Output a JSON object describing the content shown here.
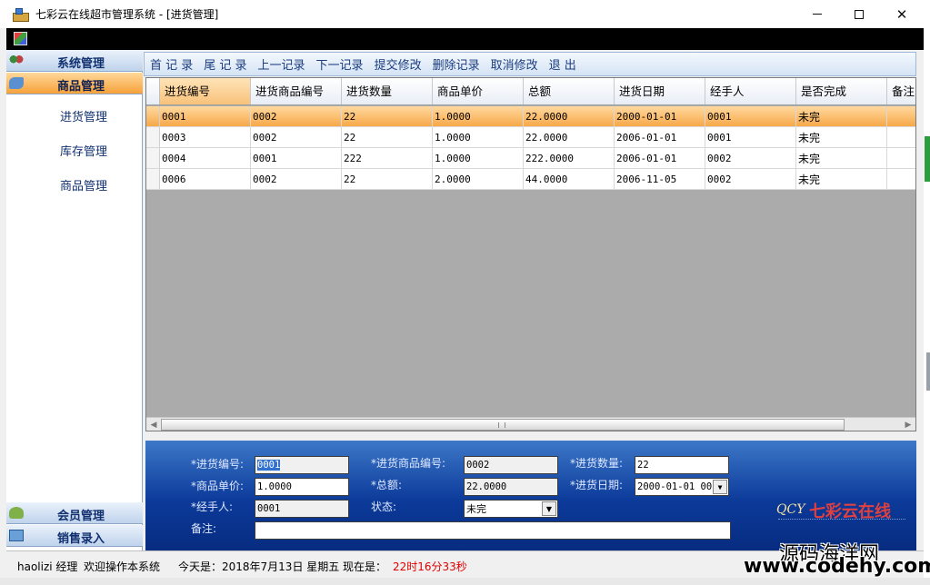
{
  "window": {
    "title": "七彩云在线超市管理系统 - [进货管理]"
  },
  "nav": {
    "sections": [
      {
        "label": "系统管理"
      },
      {
        "label": "商品管理"
      }
    ],
    "sub_items": [
      "进货管理",
      "库存管理",
      "商品管理"
    ],
    "bottom_sections": [
      {
        "label": "会员管理"
      },
      {
        "label": "销售录入"
      }
    ]
  },
  "toolbar": {
    "buttons": [
      "首 记 录",
      "尾 记 录",
      "上一记录",
      "下一记录",
      "提交修改",
      "删除记录",
      "取消修改",
      "退  出"
    ]
  },
  "grid": {
    "columns": [
      "进货编号",
      "进货商品编号",
      "进货数量",
      "商品单价",
      "总额",
      "进货日期",
      "经手人",
      "是否完成",
      "备注"
    ],
    "rows": [
      [
        "0001",
        "0002",
        "22",
        "1.0000",
        "22.0000",
        "2000-01-01",
        "0001",
        "未完",
        ""
      ],
      [
        "0003",
        "0002",
        "22",
        "1.0000",
        "22.0000",
        "2006-01-01",
        "0001",
        "未完",
        ""
      ],
      [
        "0004",
        "0001",
        "222",
        "1.0000",
        "222.0000",
        "2006-01-01",
        "0002",
        "未完",
        ""
      ],
      [
        "0006",
        "0002",
        "22",
        "2.0000",
        "44.0000",
        "2006-11-05",
        "0002",
        "未完",
        ""
      ]
    ],
    "selected_row": 0
  },
  "form": {
    "labels": {
      "id": "*进货编号:",
      "goods_id": "*进货商品编号:",
      "qty": "*进货数量:",
      "price": "*商品单价:",
      "total": "*总额:",
      "date": "*进货日期:",
      "handler": "*经手人:",
      "status": "状态:",
      "remark": "备注:"
    },
    "values": {
      "id": "0001",
      "goods_id": "0002",
      "qty": "22",
      "price": "1.0000",
      "total": "22.0000",
      "date": "2000-01-01 00",
      "handler": "0001",
      "status": "未完",
      "remark": ""
    },
    "logo": {
      "mark": "QCY",
      "text": "七彩云在线"
    }
  },
  "status": {
    "user": "haolizi 经理",
    "welcome": "欢迎操作本系统",
    "today": "今天是：2018年7月13日 星期五",
    "now_label": "现在是：",
    "time": "22时16分33秒"
  },
  "watermark": {
    "line1": "源码海洋网",
    "line2": "www.codehy.com"
  },
  "colors": {
    "form_bg": "#0c3a9a",
    "selected_row": "#f7a849",
    "active_nav": "#f6a13a",
    "time_text": "#e00000",
    "toolbar_text": "#1a3c80"
  }
}
